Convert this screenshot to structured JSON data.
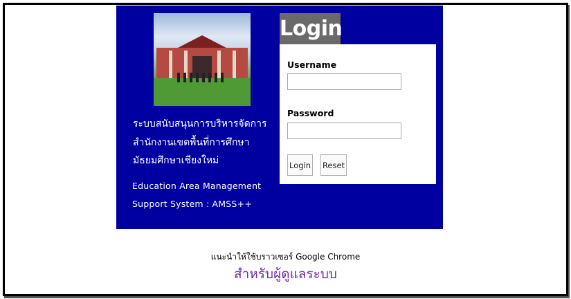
{
  "header": {
    "system_name_th": [
      "ระบบสนับสนุนการบริหารจัดการ",
      "สำนักงานเขตพื้นที่การศึกษา",
      "มัธยมศึกษาเชียงใหม่"
    ],
    "system_name_en": [
      "Education Area Management",
      "Support System : AMSS++"
    ]
  },
  "login": {
    "title": "Login",
    "username_label": "Username",
    "username_value": "",
    "password_label": "Password",
    "password_value": "",
    "login_button": "Login",
    "reset_button": "Reset"
  },
  "footer": {
    "browser_recommendation": "แนะนำให้ใช้บราวเซอร์ Google Chrome",
    "admin_link": "สำหรับผู้ดูแลระบบ"
  },
  "colors": {
    "panel": "#0000a0",
    "admin_link": "#6b2ea3"
  }
}
